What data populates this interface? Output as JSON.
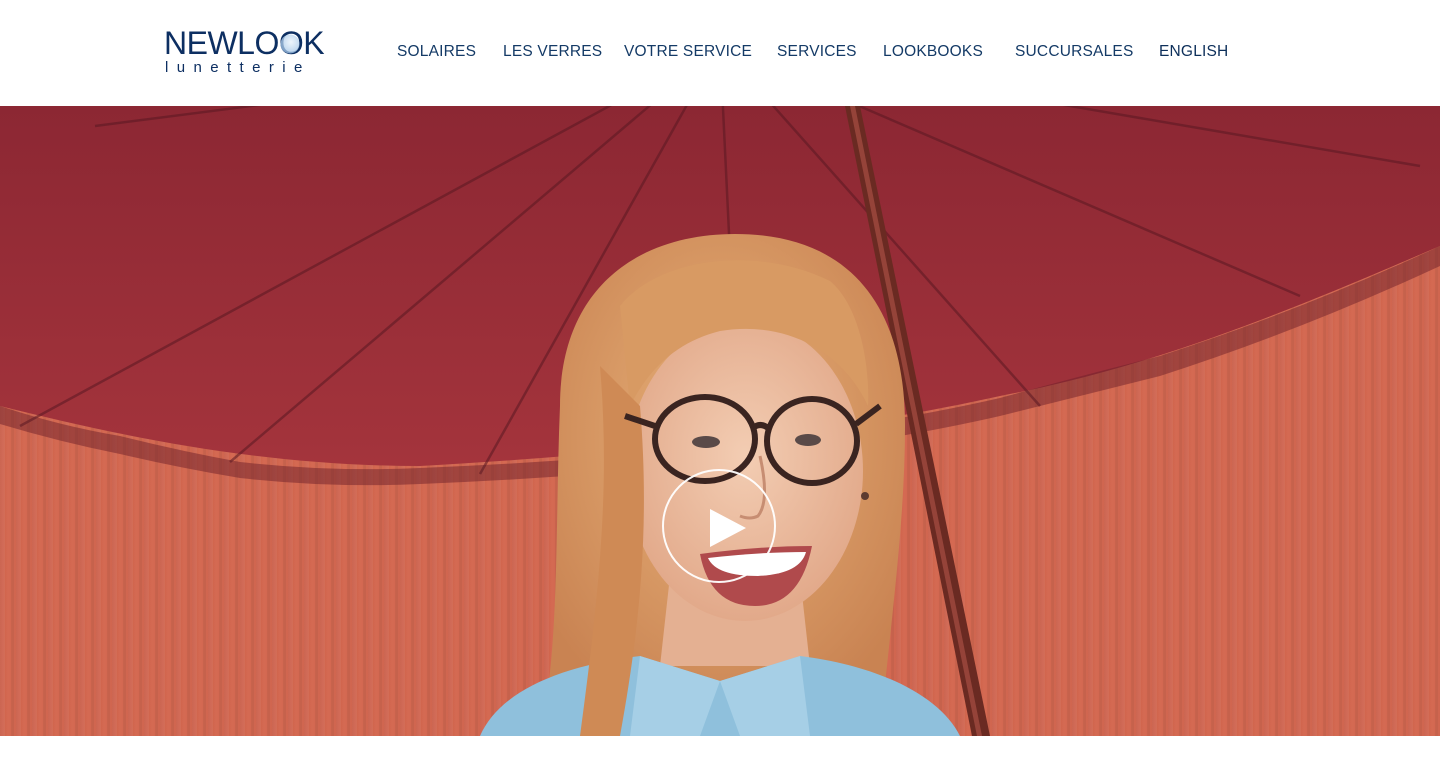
{
  "header": {
    "logo": {
      "brand": "NEWLOOK",
      "tagline": "lunetterie"
    },
    "nav": [
      {
        "label": "SOLAIRES"
      },
      {
        "label": "LES VERRES"
      },
      {
        "label": "VOTRE SERVICE"
      },
      {
        "label": "SERVICES"
      },
      {
        "label": "LOOKBOOKS"
      },
      {
        "label": "SUCCURSALES"
      },
      {
        "label": "ENGLISH"
      }
    ]
  },
  "hero": {
    "media": "video-still-woman-glasses-red-umbrella",
    "play_icon": "play-icon"
  },
  "colors": {
    "brand_navy": "#0d2f62",
    "nav_text": "#143a66",
    "umbrella_red": "#9a2f3a",
    "wall_orange": "#d0664f"
  }
}
